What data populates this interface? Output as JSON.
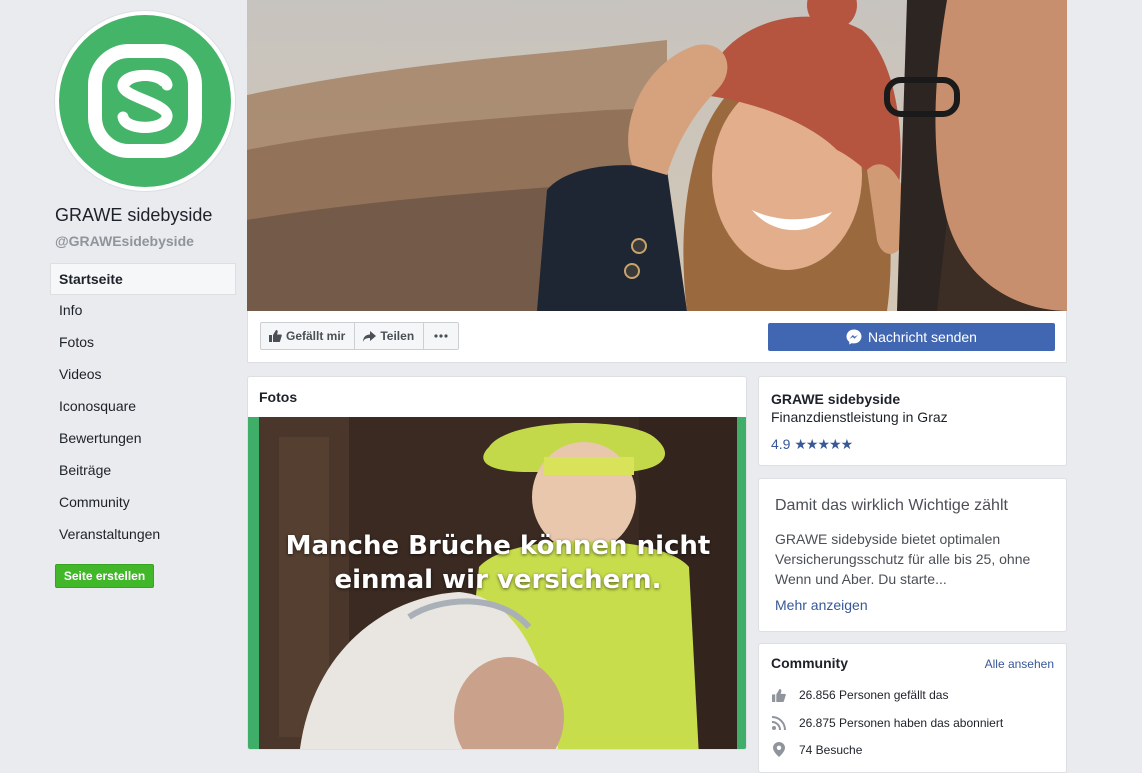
{
  "page": {
    "name": "GRAWE sidebyside",
    "handle": "@GRAWEsidebyside"
  },
  "nav": {
    "items": [
      {
        "label": "Startseite"
      },
      {
        "label": "Info"
      },
      {
        "label": "Fotos"
      },
      {
        "label": "Videos"
      },
      {
        "label": "Iconosquare"
      },
      {
        "label": "Bewertungen"
      },
      {
        "label": "Beiträge"
      },
      {
        "label": "Community"
      },
      {
        "label": "Veranstaltungen"
      }
    ],
    "active": "Startseite"
  },
  "create_page_label": "Seite erstellen",
  "actions": {
    "like_label": "Gefällt mir",
    "share_label": "Teilen",
    "message_label": "Nachricht senden"
  },
  "photos": {
    "title": "Fotos",
    "caption_line1": "Manche Brüche können nicht",
    "caption_line2": "einmal wir versichern."
  },
  "about": {
    "name": "GRAWE sidebyside",
    "category": "Finanzdienstleistung in Graz",
    "rating": "4.9",
    "stars": 5
  },
  "description": {
    "heading": "Damit das wirklich Wichtige zählt",
    "body": "GRAWE sidebyside bietet optimalen Versicherungsschutz für alle bis 25, ohne Wenn und Aber. Du starte...",
    "more_label": "Mehr anzeigen"
  },
  "community": {
    "title": "Community",
    "see_all": "Alle ansehen",
    "likes": "26.856 Personen gefällt das",
    "follows": "26.875 Personen haben das abonniert",
    "visits": "74 Besuche"
  },
  "colors": {
    "brand_green": "#44b468",
    "facebook_blue": "#4267b2",
    "link_blue": "#385898",
    "create_green": "#42b72a"
  }
}
